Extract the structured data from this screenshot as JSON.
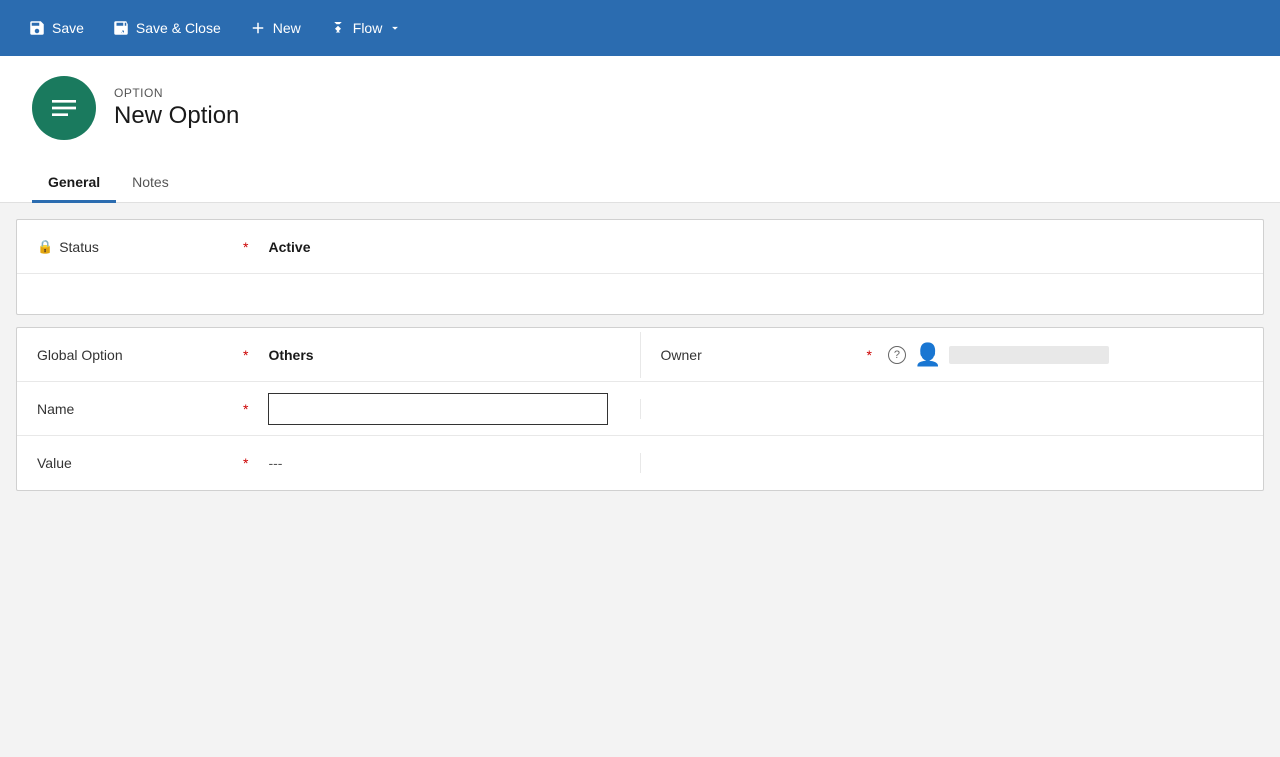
{
  "toolbar": {
    "save_label": "Save",
    "save_close_label": "Save & Close",
    "new_label": "New",
    "flow_label": "Flow"
  },
  "entity": {
    "type_label": "OPTION",
    "name": "New Option"
  },
  "tabs": [
    {
      "id": "general",
      "label": "General",
      "active": true
    },
    {
      "id": "notes",
      "label": "Notes",
      "active": false
    }
  ],
  "status_section": {
    "field_label": "Status",
    "required": "*",
    "value": "Active"
  },
  "details_section": {
    "global_option_label": "Global Option",
    "global_option_required": "*",
    "global_option_value": "Others",
    "owner_label": "Owner",
    "owner_required": "*",
    "name_label": "Name",
    "name_required": "*",
    "name_value": "",
    "value_label": "Value",
    "value_required": "*",
    "value_value": "---"
  }
}
